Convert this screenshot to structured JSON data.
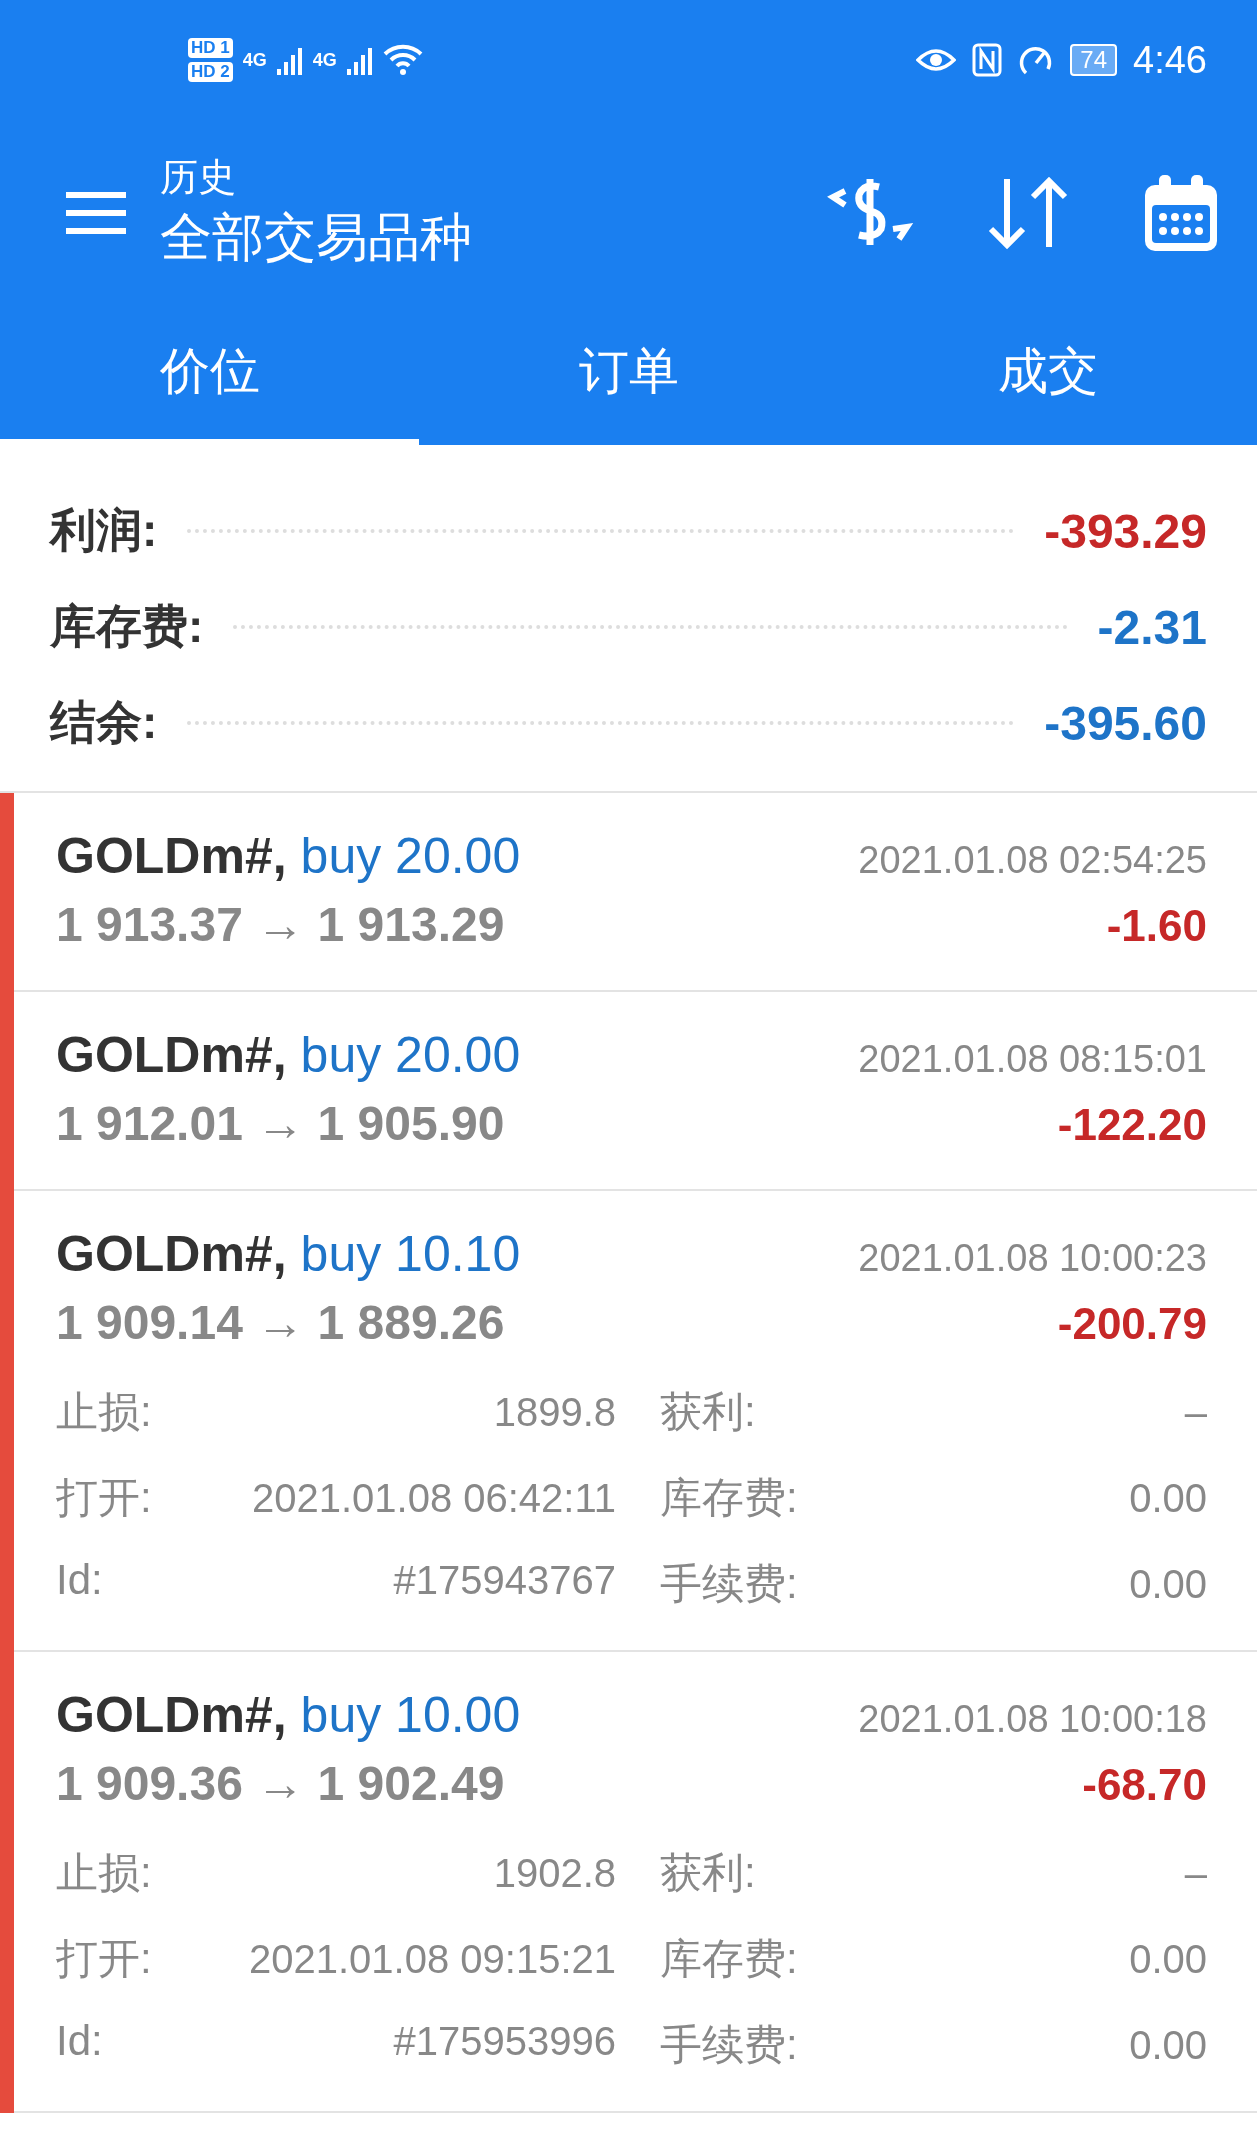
{
  "status_bar": {
    "sims": [
      {
        "label": "HD",
        "slot": "1"
      },
      {
        "label": "HD",
        "slot": "2"
      }
    ],
    "networks": [
      "4G",
      "4G"
    ],
    "battery": "74",
    "time": "4:46"
  },
  "header": {
    "subtitle": "历史",
    "title": "全部交易品种"
  },
  "tabs": [
    {
      "label": "价位",
      "selected": true
    },
    {
      "label": "订单",
      "selected": false
    },
    {
      "label": "成交",
      "selected": false
    }
  ],
  "summary": [
    {
      "label": "利润:",
      "value": "-393.29",
      "color": "#c62828"
    },
    {
      "label": "库存费:",
      "value": "-2.31",
      "color": "#1e74c8"
    },
    {
      "label": "结余:",
      "value": "-395.60",
      "color": "#1e74c8"
    }
  ],
  "deals": [
    {
      "symbol": "GOLDm#,",
      "side": "buy 20.00",
      "time": "2021.01.08 02:54:25",
      "prices": "1 913.37 → 1 913.29",
      "profit": "-1.60"
    },
    {
      "symbol": "GOLDm#,",
      "side": "buy 20.00",
      "time": "2021.01.08 08:15:01",
      "prices": "1 912.01 → 1 905.90",
      "profit": "-122.20"
    },
    {
      "symbol": "GOLDm#,",
      "side": "buy 10.10",
      "time": "2021.01.08 10:00:23",
      "prices": "1 909.14 → 1 889.26",
      "profit": "-200.79",
      "details": [
        {
          "label": "止损:",
          "value": "1899.8",
          "label_2": "获利:",
          "value_2": "–"
        },
        {
          "label": "打开:",
          "value": "2021.01.08 06:42:11",
          "label_2": "库存费:",
          "value_2": "0.00"
        },
        {
          "label": "Id:",
          "value": "#175943767",
          "label_2": "手续费:",
          "value_2": "0.00"
        }
      ]
    },
    {
      "symbol": "GOLDm#,",
      "side": "buy 10.00",
      "time": "2021.01.08 10:00:18",
      "prices": "1 909.36 → 1 902.49",
      "profit": "-68.70",
      "details": [
        {
          "label": "止损:",
          "value": "1902.8",
          "label_2": "获利:",
          "value_2": "–"
        },
        {
          "label": "打开:",
          "value": "2021.01.08 09:15:21",
          "label_2": "库存费:",
          "value_2": "0.00"
        },
        {
          "label": "Id:",
          "value": "#175953996",
          "label_2": "手续费:",
          "value_2": "0.00"
        }
      ]
    }
  ]
}
